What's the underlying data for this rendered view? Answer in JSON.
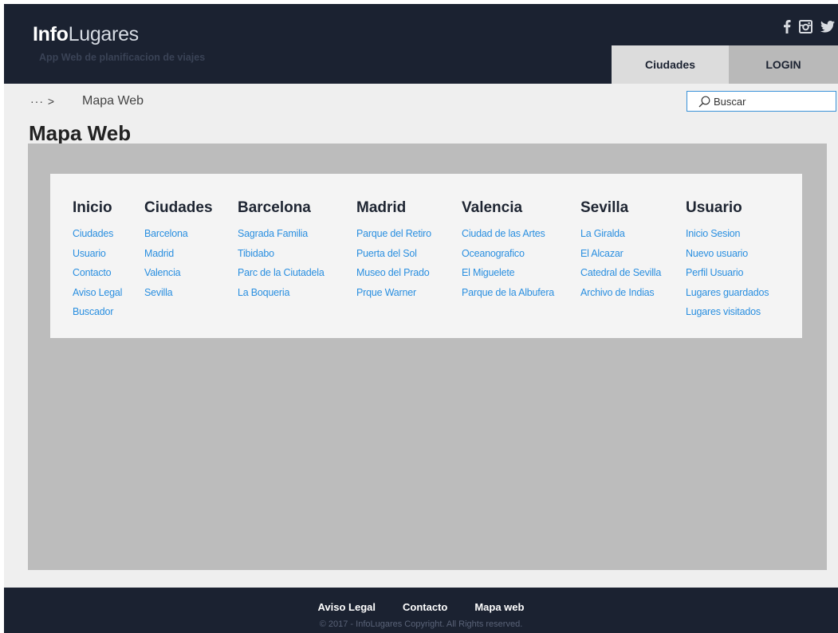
{
  "header": {
    "brand_bold": "Info",
    "brand_light": "Lugares",
    "tagline": "App Web de planificacion de viajes",
    "social": [
      "facebook-icon",
      "instagram-icon",
      "twitter-icon"
    ],
    "nav": {
      "ciudades": "Ciudades",
      "login": "LOGIN"
    }
  },
  "breadcrumb": {
    "dots": "··· >",
    "current": "Mapa Web"
  },
  "search": {
    "placeholder": "Buscar"
  },
  "page_title": "Mapa Web",
  "sitemap": [
    {
      "title": "Inicio",
      "links": [
        "Ciudades",
        "Usuario",
        "Contacto",
        "Aviso Legal",
        "Buscador"
      ]
    },
    {
      "title": "Ciudades",
      "links": [
        "Barcelona",
        "Madrid",
        "Valencia",
        "Sevilla"
      ]
    },
    {
      "title": "Barcelona",
      "links": [
        "Sagrada Familia",
        "Tibidabo",
        "Parc de la Ciutadela",
        "La Boqueria"
      ]
    },
    {
      "title": "Madrid",
      "links": [
        "Parque del Retiro",
        "Puerta del Sol",
        "Museo del Prado",
        "Prque Warner"
      ]
    },
    {
      "title": "Valencia",
      "links": [
        "Ciudad de las Artes",
        "Oceanografico",
        "El Miguelete",
        "Parque de la Albufera"
      ]
    },
    {
      "title": "Sevilla",
      "links": [
        "La Giralda",
        "El Alcazar",
        "Catedral de Sevilla",
        "Archivo de Indias"
      ]
    },
    {
      "title": "Usuario",
      "links": [
        "Inicio Sesion",
        "Nuevo usuario",
        "Perfil Usuario",
        "Lugares guardados",
        "Lugares visitados"
      ]
    }
  ],
  "footer": {
    "links": [
      "Aviso Legal",
      "Contacto",
      "Mapa web"
    ],
    "copyright": "© 2017 - InfoLugares Copyright. All Rights reserved."
  },
  "colors": {
    "header_bg": "#1b2231",
    "link": "#2a8fe0",
    "search_border": "#3a92d8"
  }
}
